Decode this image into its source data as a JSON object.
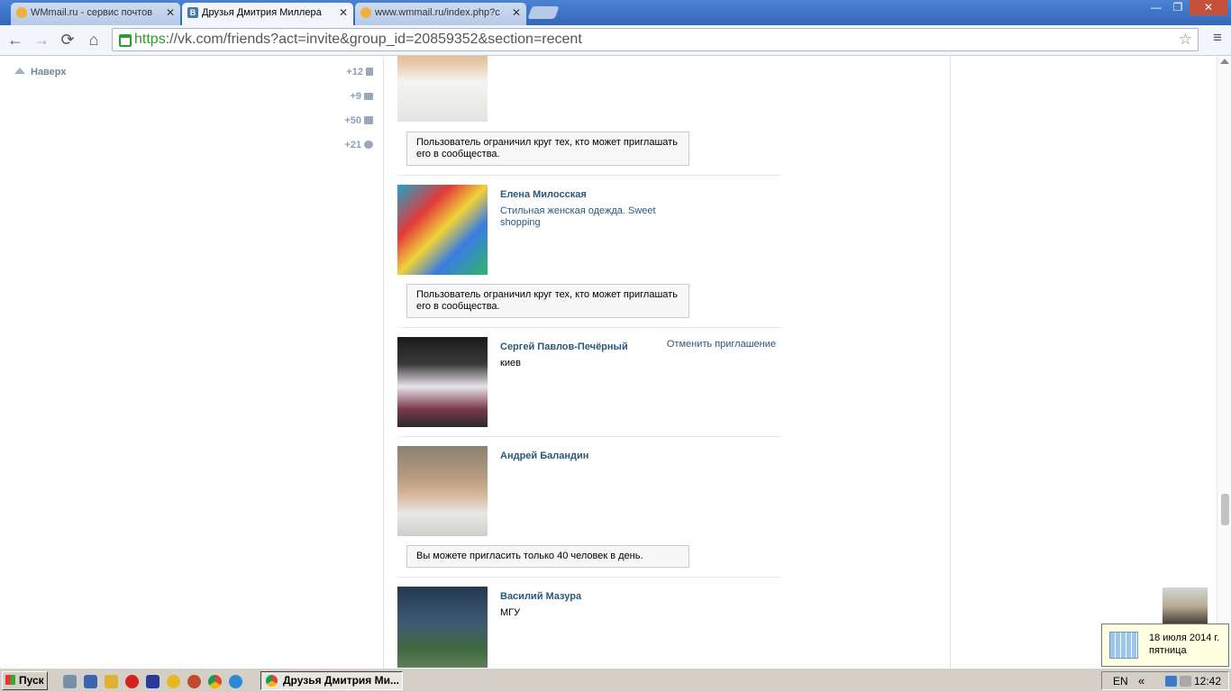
{
  "tabs": [
    {
      "title": "WMmail.ru - сервис почтов",
      "icon": "wmmail-favicon"
    },
    {
      "title": "Друзья Дмитрия Миллера",
      "icon": "vk-favicon",
      "active": true
    },
    {
      "title": "www.wmmail.ru/index.php?c",
      "icon": "wmmail-favicon"
    }
  ],
  "tab_close": "✕",
  "vk_letter": "В",
  "window_controls": {
    "minimize": "—",
    "maximize": "❐",
    "close": "✕"
  },
  "address_bar": {
    "protocol": "https",
    "rest": "://vk.com/friends?act=invite&group_id=20859352&section=recent"
  },
  "nav_icons": {
    "back": "←",
    "forward": "→",
    "reload": "⟳",
    "home": "⌂",
    "star": "☆",
    "menu": "≡"
  },
  "sidebar": {
    "up_label": "Наверх",
    "counters": [
      {
        "value": "+12",
        "icon": "phone-icon"
      },
      {
        "value": "+9",
        "icon": "mail-icon"
      },
      {
        "value": "+50",
        "icon": "comment-icon"
      },
      {
        "value": "+21",
        "icon": "gear-icon"
      }
    ]
  },
  "friends": [
    {
      "name": "",
      "status": "",
      "notice": "Пользователь ограничил круг тех, кто может приглашать его в сообщества."
    },
    {
      "name": "Елена Милосская",
      "status": "Стильная женская одежда. Sweet shopping",
      "notice": "Пользователь ограничил круг тех, кто может приглашать его в сообщества."
    },
    {
      "name": "Сергей Павлов-Печёрный",
      "status": "киев",
      "action": "Отменить приглашение"
    },
    {
      "name": "Андрей Баландин",
      "status": "",
      "notice": "Вы можете пригласить только 40 человек в день."
    },
    {
      "name": "Василий Мазура",
      "status": "МГУ"
    }
  ],
  "date_popup": {
    "date": "18 июля 2014 г.",
    "weekday": "пятница"
  },
  "taskbar": {
    "start_label": "Пуск",
    "active_window": "Друзья Дмитрия Ми...",
    "lang": "EN",
    "tray_chevron": "«",
    "clock": "12:42"
  },
  "colors": {
    "vk_link": "#2b587a",
    "titlebar": "#3a6fc1"
  }
}
